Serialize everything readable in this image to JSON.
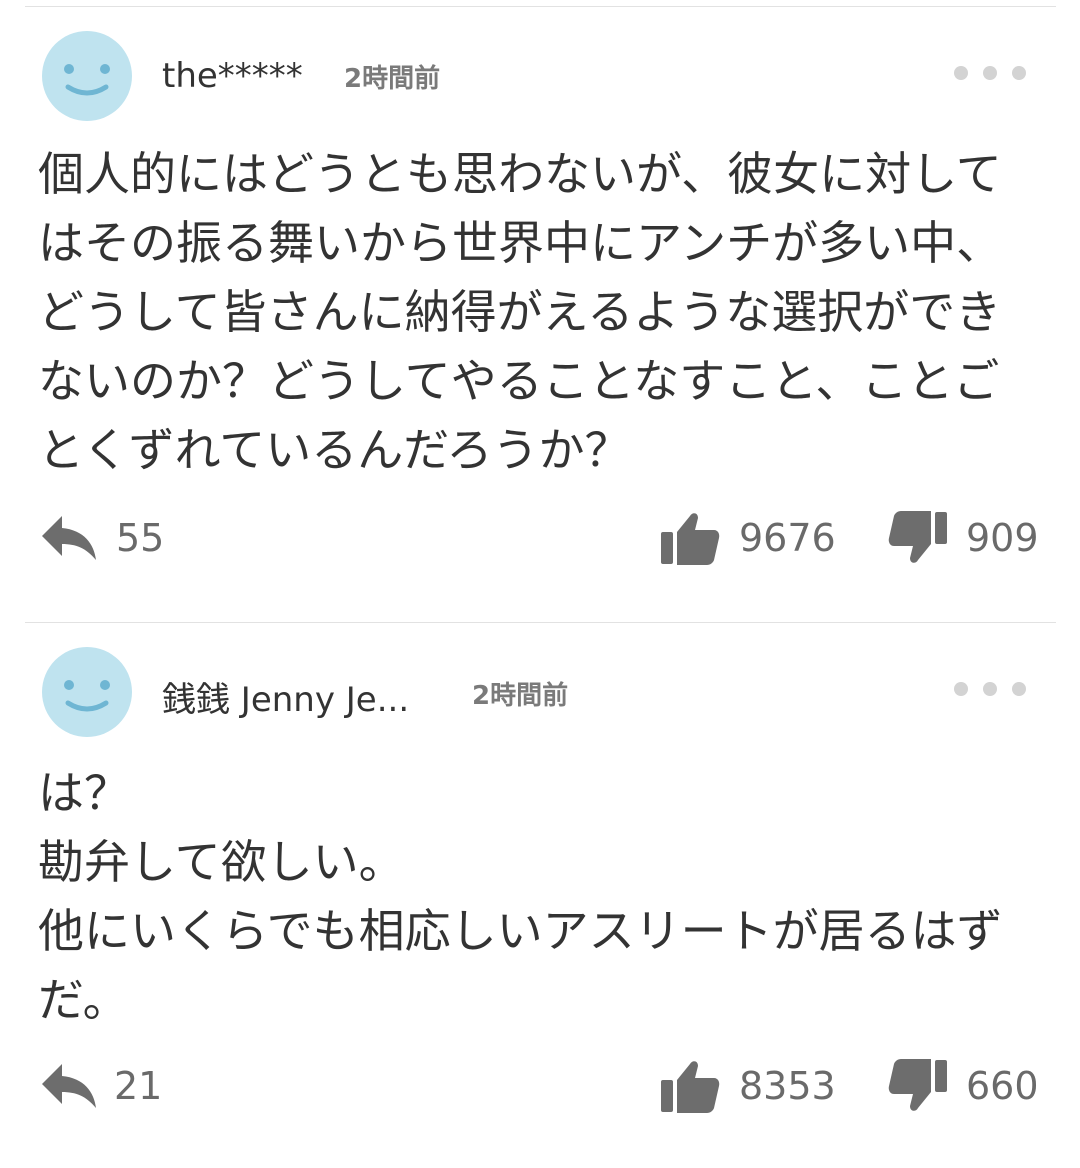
{
  "comments": [
    {
      "username": "the*****",
      "timestamp": "2時間前",
      "body_lines": [
        "個人的にはどうとも思わないが、彼女に対して",
        "はその振る舞いから世界中にアンチが多い中、",
        "どうして皆さんに納得がえるような選択ができ",
        "ないのか？どうしてやることなすこと、ことご",
        "とくずれているんだろうか？"
      ],
      "reply_count": "55",
      "like_count": "9676",
      "dislike_count": "909"
    },
    {
      "username": "銭銭 Jenny Je...",
      "timestamp": "2時間前",
      "body_lines": [
        "は？",
        "勘弁して欲しい。",
        "他にいくらでも相応しいアスリートが居るはず",
        "だ。"
      ],
      "reply_count": "21",
      "like_count": "8353",
      "dislike_count": "660"
    }
  ],
  "icons": {
    "avatar": "smiley-face-icon",
    "reply": "reply-arrow-icon",
    "like": "thumbs-up-icon",
    "dislike": "thumbs-down-icon",
    "more": "more-dots-icon"
  },
  "colors": {
    "avatar_bg": "#bfe3ef",
    "avatar_face": "#6fb6d3",
    "icon_gray": "#6d6d6d",
    "text": "#333333",
    "meta": "#7a7a7a"
  }
}
